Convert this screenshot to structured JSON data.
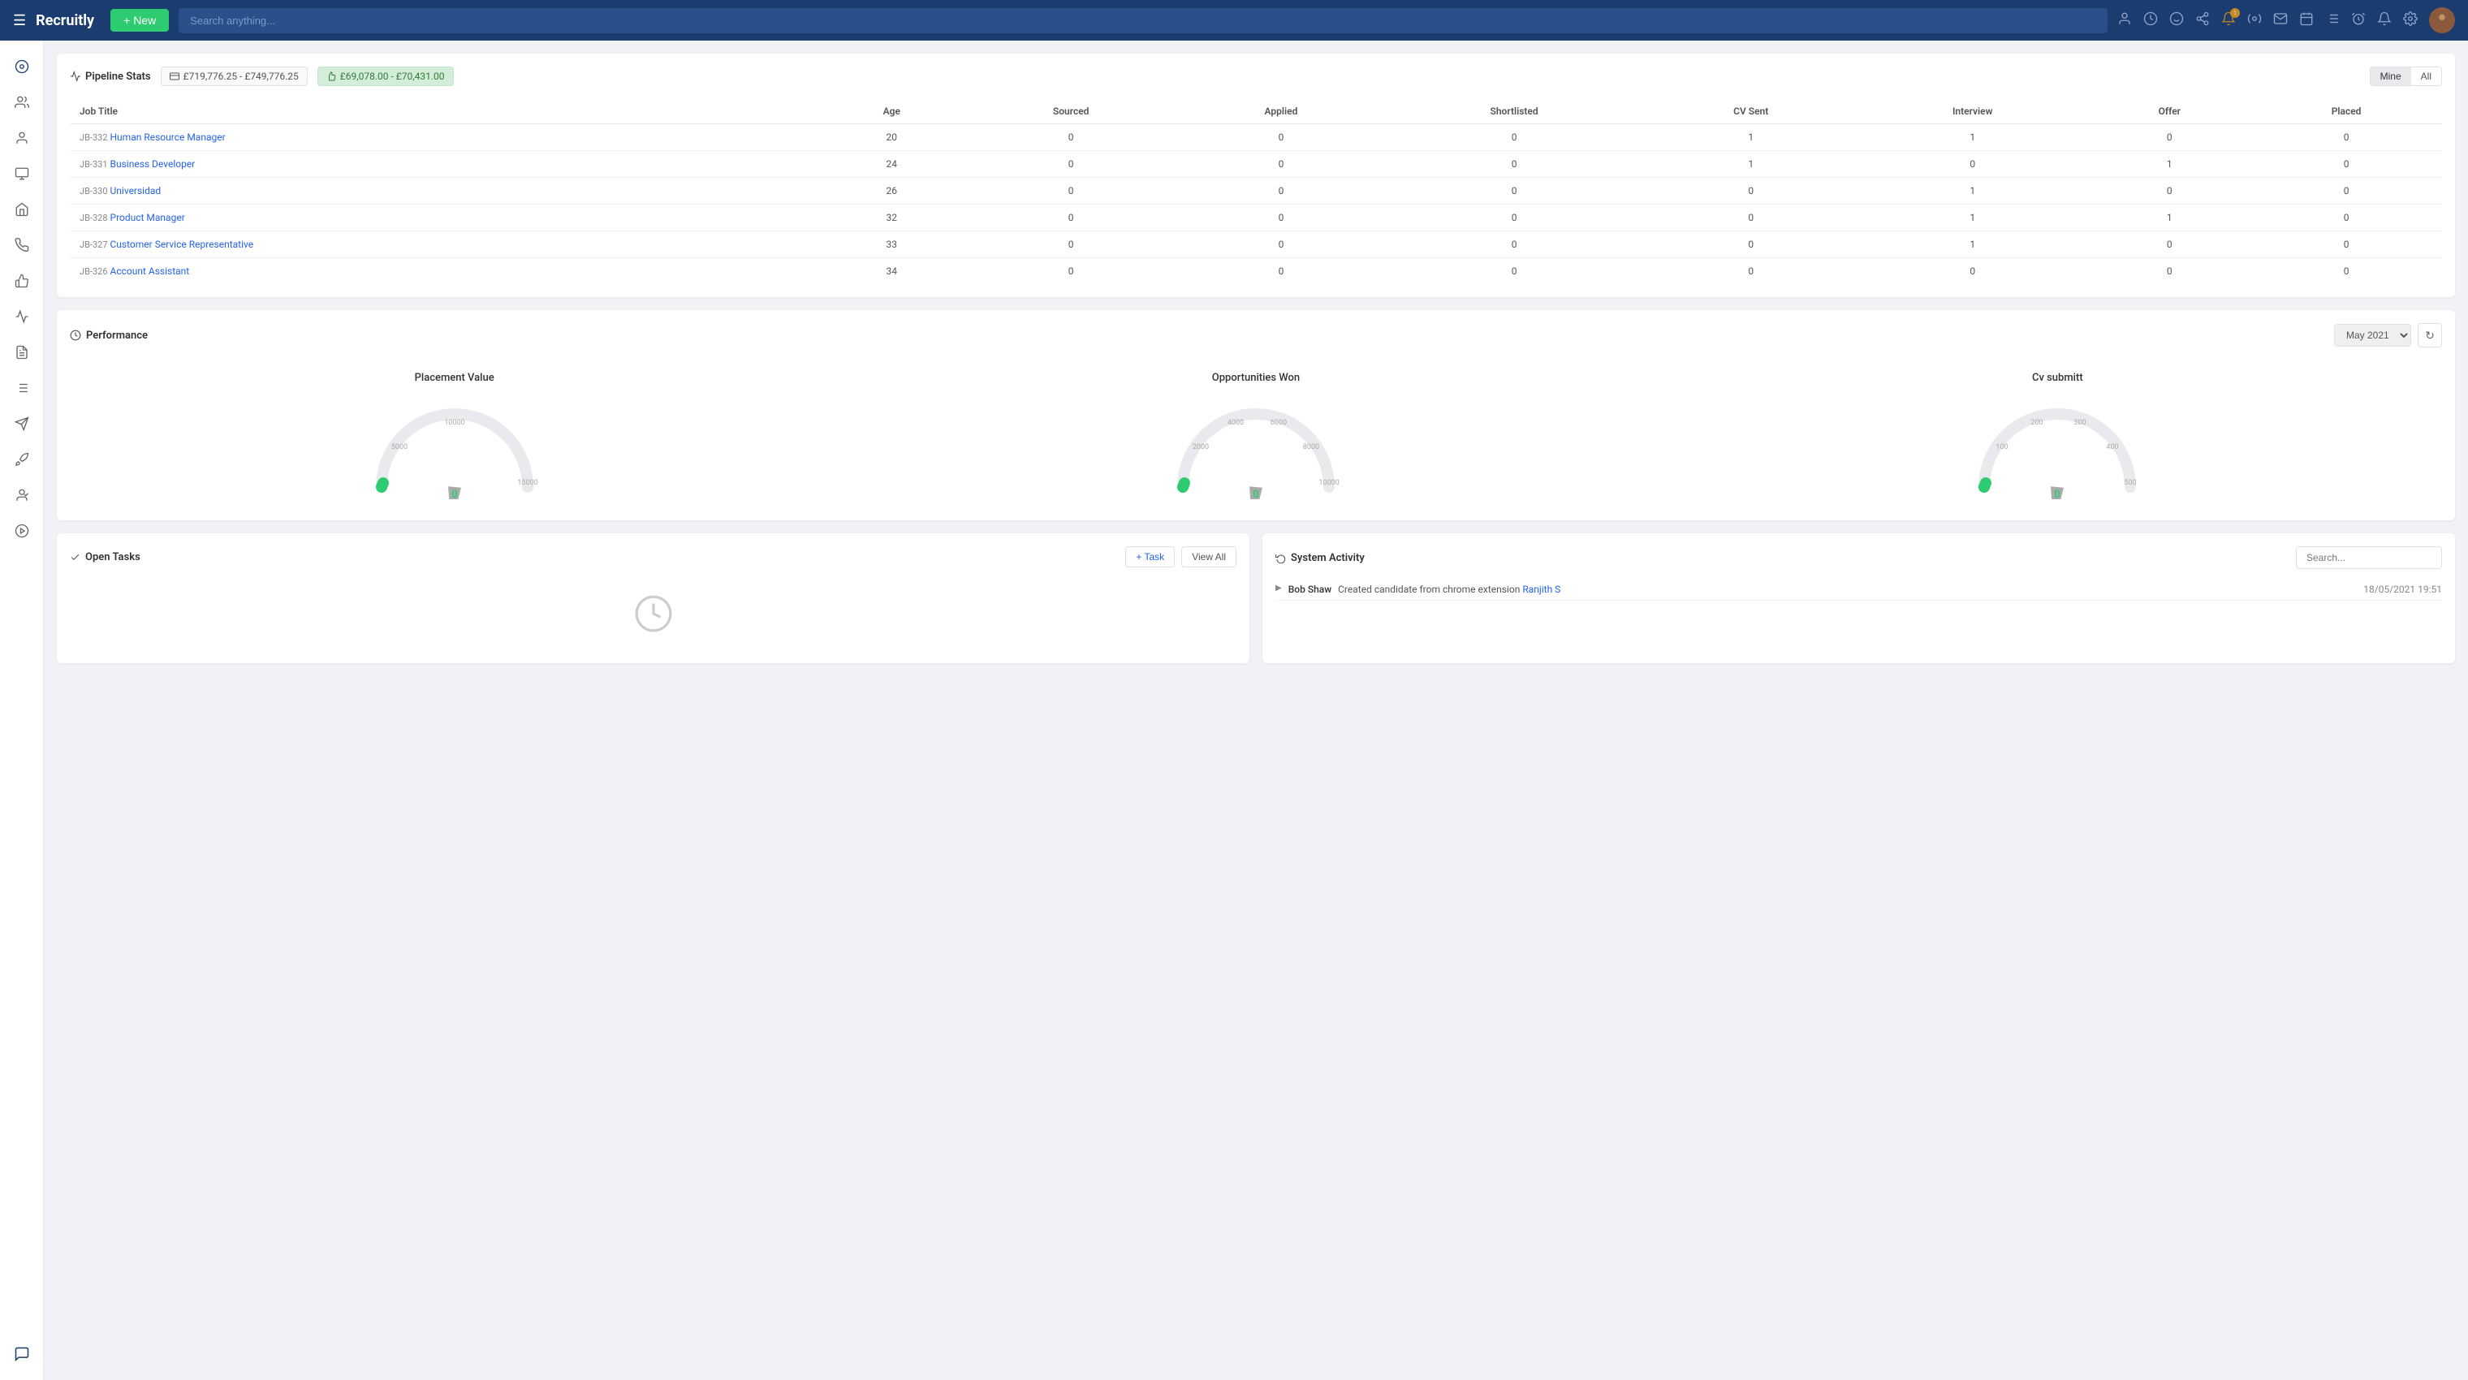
{
  "app": {
    "name": "Recruitly",
    "new_button": "+ New",
    "search_placeholder": "Search anything..."
  },
  "topnav": {
    "icons": [
      "person-icon",
      "clock-icon",
      "face-icon",
      "fork-icon",
      "bell-orange-icon",
      "settings-circle-icon",
      "mail-icon",
      "calendar-icon",
      "list-icon",
      "alarm-icon",
      "bell-icon",
      "gear-icon"
    ]
  },
  "pipeline": {
    "title": "Pipeline Stats",
    "badge1": "£719,776.25 - £749,776.25",
    "badge2": "£69,078.00 - £70,431.00",
    "mine_label": "Mine",
    "all_label": "All"
  },
  "table": {
    "columns": [
      "Job Title",
      "Age",
      "Sourced",
      "Applied",
      "Shortlisted",
      "CV Sent",
      "Interview",
      "Offer",
      "Placed"
    ],
    "rows": [
      {
        "id": "JB-332",
        "title": "Human Resource Manager",
        "age": 20,
        "sourced": 0,
        "applied": 0,
        "shortlisted": 0,
        "cv_sent": 1,
        "interview": 1,
        "offer": 0,
        "placed": 0
      },
      {
        "id": "JB-331",
        "title": "Business Developer",
        "age": 24,
        "sourced": 0,
        "applied": 0,
        "shortlisted": 0,
        "cv_sent": 1,
        "interview": 0,
        "offer": 1,
        "placed": 0
      },
      {
        "id": "JB-330",
        "title": "Universidad",
        "age": 26,
        "sourced": 0,
        "applied": 0,
        "shortlisted": 0,
        "cv_sent": 0,
        "interview": 1,
        "offer": 0,
        "placed": 0
      },
      {
        "id": "JB-328",
        "title": "Product Manager",
        "age": 32,
        "sourced": 0,
        "applied": 0,
        "shortlisted": 0,
        "cv_sent": 0,
        "interview": 1,
        "offer": 1,
        "placed": 0
      },
      {
        "id": "JB-327",
        "title": "Customer Service Representative",
        "age": 33,
        "sourced": 0,
        "applied": 0,
        "shortlisted": 0,
        "cv_sent": 0,
        "interview": 1,
        "offer": 0,
        "placed": 0
      },
      {
        "id": "JB-326",
        "title": "Account Assistant",
        "age": 34,
        "sourced": 0,
        "applied": 0,
        "shortlisted": 0,
        "cv_sent": 0,
        "interview": 0,
        "offer": 0,
        "placed": 0
      }
    ]
  },
  "performance": {
    "title": "Performance",
    "date_filter": "May 2021",
    "gauges": [
      {
        "label": "Placement Value",
        "value": "0",
        "max": 15000,
        "ticks": [
          "5000",
          "10000",
          "",
          "",
          "15000"
        ],
        "color": "#2ecc71",
        "fill_pct": 2
      },
      {
        "label": "Opportunities Won",
        "value": "0",
        "max": 10000,
        "ticks": [
          "2000",
          "4000",
          "6000",
          "8000",
          "10000"
        ],
        "color": "#2ecc71",
        "fill_pct": 2
      },
      {
        "label": "Cv submitt",
        "value": "0",
        "max": 500,
        "ticks": [
          "100",
          "200",
          "300",
          "400",
          "500"
        ],
        "color": "#2ecc71",
        "fill_pct": 2
      }
    ]
  },
  "tasks": {
    "title": "Open Tasks",
    "add_label": "+ Task",
    "view_all_label": "View All"
  },
  "activity": {
    "title": "System Activity",
    "search_placeholder": "Search...",
    "entries": [
      {
        "user": "Bob Shaw",
        "description": "Created candidate from chrome extension",
        "link": "Ranjith S",
        "time": "18/05/2021 19:51"
      }
    ]
  }
}
